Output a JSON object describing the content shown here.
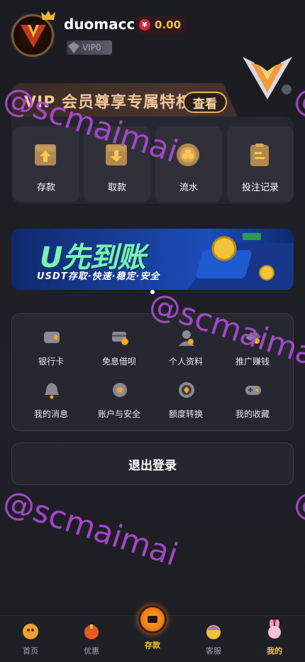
{
  "profile": {
    "username": "duomacc",
    "balance_symbol": "¥",
    "balance": "0.00",
    "vip_level": "VIP0"
  },
  "vip_banner": {
    "title": "VIP 会员尊享专属特权",
    "view_label": "查看"
  },
  "quick_actions": [
    {
      "label": "存款",
      "icon": "deposit-icon"
    },
    {
      "label": "取款",
      "icon": "withdraw-icon"
    },
    {
      "label": "流水",
      "icon": "turnover-icon"
    },
    {
      "label": "投注记录",
      "icon": "bet-record-icon"
    }
  ],
  "promo": {
    "title": "U先到账",
    "subtitle": "USDT存取·快速·稳定·安全"
  },
  "services": [
    {
      "label": "银行卡",
      "icon": "wallet-icon"
    },
    {
      "label": "免息借呗",
      "icon": "card-loan-icon"
    },
    {
      "label": "个人资料",
      "icon": "profile-icon"
    },
    {
      "label": "推广赚钱",
      "icon": "handshake-icon"
    },
    {
      "label": "我的消息",
      "icon": "bell-icon"
    },
    {
      "label": "账户与安全",
      "icon": "gear-icon"
    },
    {
      "label": "额度转换",
      "icon": "exchange-icon"
    },
    {
      "label": "我的收藏",
      "icon": "gamepad-icon"
    }
  ],
  "logout_label": "退出登录",
  "watermark": "@scmaimai",
  "tabs": [
    {
      "label": "首页",
      "icon": "home-icon"
    },
    {
      "label": "优惠",
      "icon": "gift-icon"
    },
    {
      "label": "存款",
      "icon": "wallet-icon"
    },
    {
      "label": "客服",
      "icon": "support-icon"
    },
    {
      "label": "我的",
      "icon": "bunny-icon"
    }
  ],
  "colors": {
    "accent": "#f5c042",
    "background": "#1c1d22",
    "card": "#27282f",
    "vip_gold": "#f3c79a"
  }
}
